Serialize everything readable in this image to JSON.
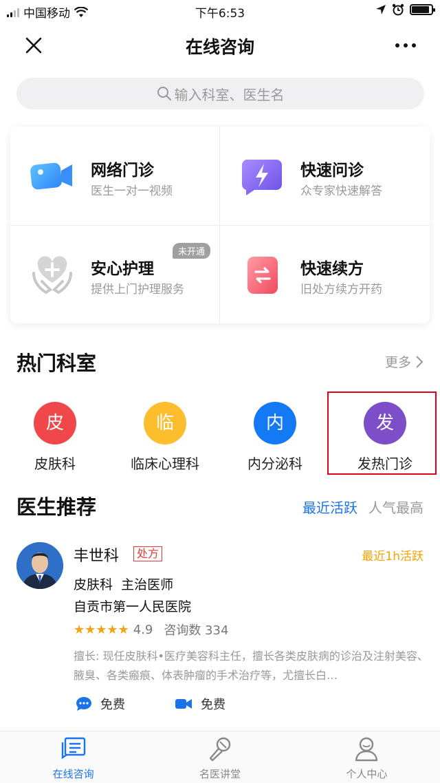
{
  "status": {
    "carrier": "中国移动",
    "time": "下午6:53",
    "battery_level": 0.9
  },
  "nav": {
    "title": "在线咨询"
  },
  "search": {
    "placeholder": "输入科室、医生名"
  },
  "services": [
    {
      "title": "网络门诊",
      "subtitle": "医生一对一视频",
      "icon": "video-camera-icon"
    },
    {
      "title": "快速问诊",
      "subtitle": "众专家快速解答",
      "icon": "lightning-chat-icon"
    },
    {
      "title": "安心护理",
      "subtitle": "提供上门护理服务",
      "icon": "care-hands-icon",
      "badge": "未开通"
    },
    {
      "title": "快速续方",
      "subtitle": "旧处方续方开药",
      "icon": "renew-prescription-icon"
    }
  ],
  "departments_section": {
    "title": "热门科室",
    "more": "更多"
  },
  "departments": [
    {
      "char": "皮",
      "label": "皮肤科",
      "color": "#f0474a"
    },
    {
      "char": "临",
      "label": "临床心理科",
      "color": "#fcbe2c"
    },
    {
      "char": "内",
      "label": "内分泌科",
      "color": "#1479f5"
    },
    {
      "char": "发",
      "label": "发热门诊",
      "color": "#7c4ec8"
    }
  ],
  "doctors_section": {
    "title": "医生推荐",
    "sort_tabs": [
      {
        "label": "最近活跃",
        "active": true
      },
      {
        "label": "人气最高",
        "active": false
      }
    ]
  },
  "doctor": {
    "name": "丰世科",
    "badge": "处方",
    "active": "最近1h活跃",
    "department": "皮肤科",
    "title": "主治医师",
    "hospital": "自贡市第一人民医院",
    "rating": "4.9",
    "consult_count": "咨询数 334",
    "description": "擅长: 现任皮肤科•医疗美容科主任，擅长各类皮肤病的诊治及注射美容、腋臭、各类瘢痕、体表肿瘤的手术治疗等，尤擅长白…",
    "fees": [
      {
        "icon": "chat-bubble-icon",
        "label": "免费"
      },
      {
        "icon": "video-icon",
        "label": "免费"
      }
    ]
  },
  "tabbar": [
    {
      "label": "在线咨询",
      "active": true
    },
    {
      "label": "名医讲堂",
      "active": false
    },
    {
      "label": "个人中心",
      "active": false
    }
  ],
  "colors": {
    "accent": "#1a73e8",
    "inactive": "#888888",
    "highlight_box": "#e0001b"
  }
}
